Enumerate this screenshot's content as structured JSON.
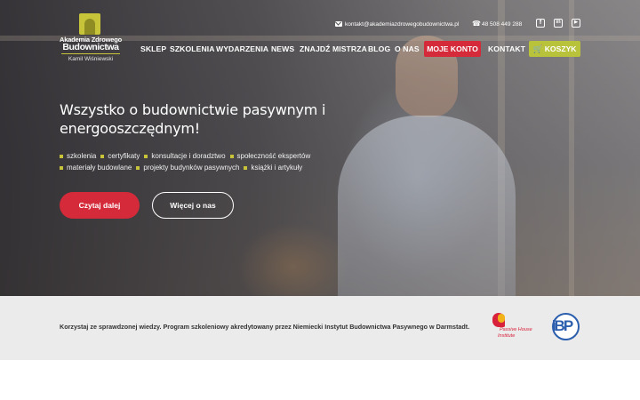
{
  "logo": {
    "line1": "Akademia Zdrowego",
    "line2": "Budownictwa",
    "line3": "Kamil Wiśniewski"
  },
  "contact": {
    "email": "kontakt@akademiazdrowegobudownictwa.pl",
    "phone": "48 508 449 288",
    "icons": [
      "mail-icon",
      "phone-icon"
    ]
  },
  "social_icons": [
    "facebook-icon",
    "linkedin-icon",
    "youtube-icon"
  ],
  "nav": {
    "items": [
      "SKLEP",
      "SZKOLENIA",
      "WYDARZENIA",
      "NEWS",
      "ZNAJDŹ MISTRZA",
      "BLOG",
      "O NAS"
    ],
    "account": "MOJE KONTO",
    "contact": "KONTAKT",
    "cart": "KOSZYK"
  },
  "hero": {
    "title": "Wszystko o budownictwie pasywnym i energooszczędnym!",
    "tags_row1": [
      "szkolenia",
      "certyfikaty",
      "konsultacje i doradztwo",
      "społeczność ekspertów"
    ],
    "tags_row2": [
      "materiały budowlane",
      "projekty budynków pasywnych",
      "książki i artykuły"
    ],
    "primary_button": "Czytaj dalej",
    "secondary_button": "Więcej o nas"
  },
  "accreditation": {
    "text": "Korzystaj ze sprawdzonej wiedzy. Program szkoleniowy akredytowany przez Niemiecki Instytut Budownictwa Pasywnego w Darmstadt.",
    "logo1_line1": "Passive House",
    "logo1_line2": "Institute",
    "logo2": "iBP"
  },
  "colors": {
    "accent_red": "#d42a3a",
    "accent_olive": "#b8c23a",
    "band_bg": "#ebebeb"
  }
}
